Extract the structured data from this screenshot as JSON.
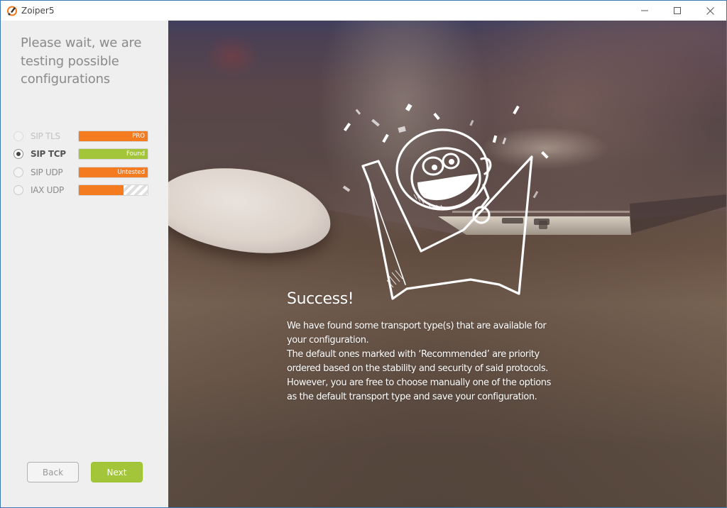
{
  "window": {
    "title": "Zoiper5",
    "controls": {
      "minimize": "minimize",
      "maximize": "maximize",
      "close": "close"
    }
  },
  "sidebar": {
    "title": "Please wait, we are testing possible configurations",
    "transports": [
      {
        "label": "SIP TLS",
        "status": "PRO",
        "state": "disabled",
        "selected": false,
        "progress": 1.0,
        "color": "#f47b20"
      },
      {
        "label": "SIP TCP",
        "status": "Found",
        "state": "active",
        "selected": true,
        "progress": 1.0,
        "color": "#a3c539"
      },
      {
        "label": "SIP UDP",
        "status": "Untested",
        "state": "normal",
        "selected": false,
        "progress": 1.0,
        "color": "#f47b20"
      },
      {
        "label": "IAX UDP",
        "status": "",
        "state": "normal",
        "selected": false,
        "progress": 0.65,
        "color": "#f47b20"
      }
    ],
    "back_label": "Back",
    "next_label": "Next"
  },
  "main": {
    "heading": "Success!",
    "message": "We have found some transport type(s) that are available for\nyour configuration.\nThe default ones marked with ‘Recommended’ are priority\nordered based on the stability and security of said protocols.\nHowever, you are free to choose manually one of the options\nas the default  transport type and save your configuration."
  },
  "colors": {
    "accent_orange": "#f47b20",
    "accent_green": "#a3c539"
  }
}
